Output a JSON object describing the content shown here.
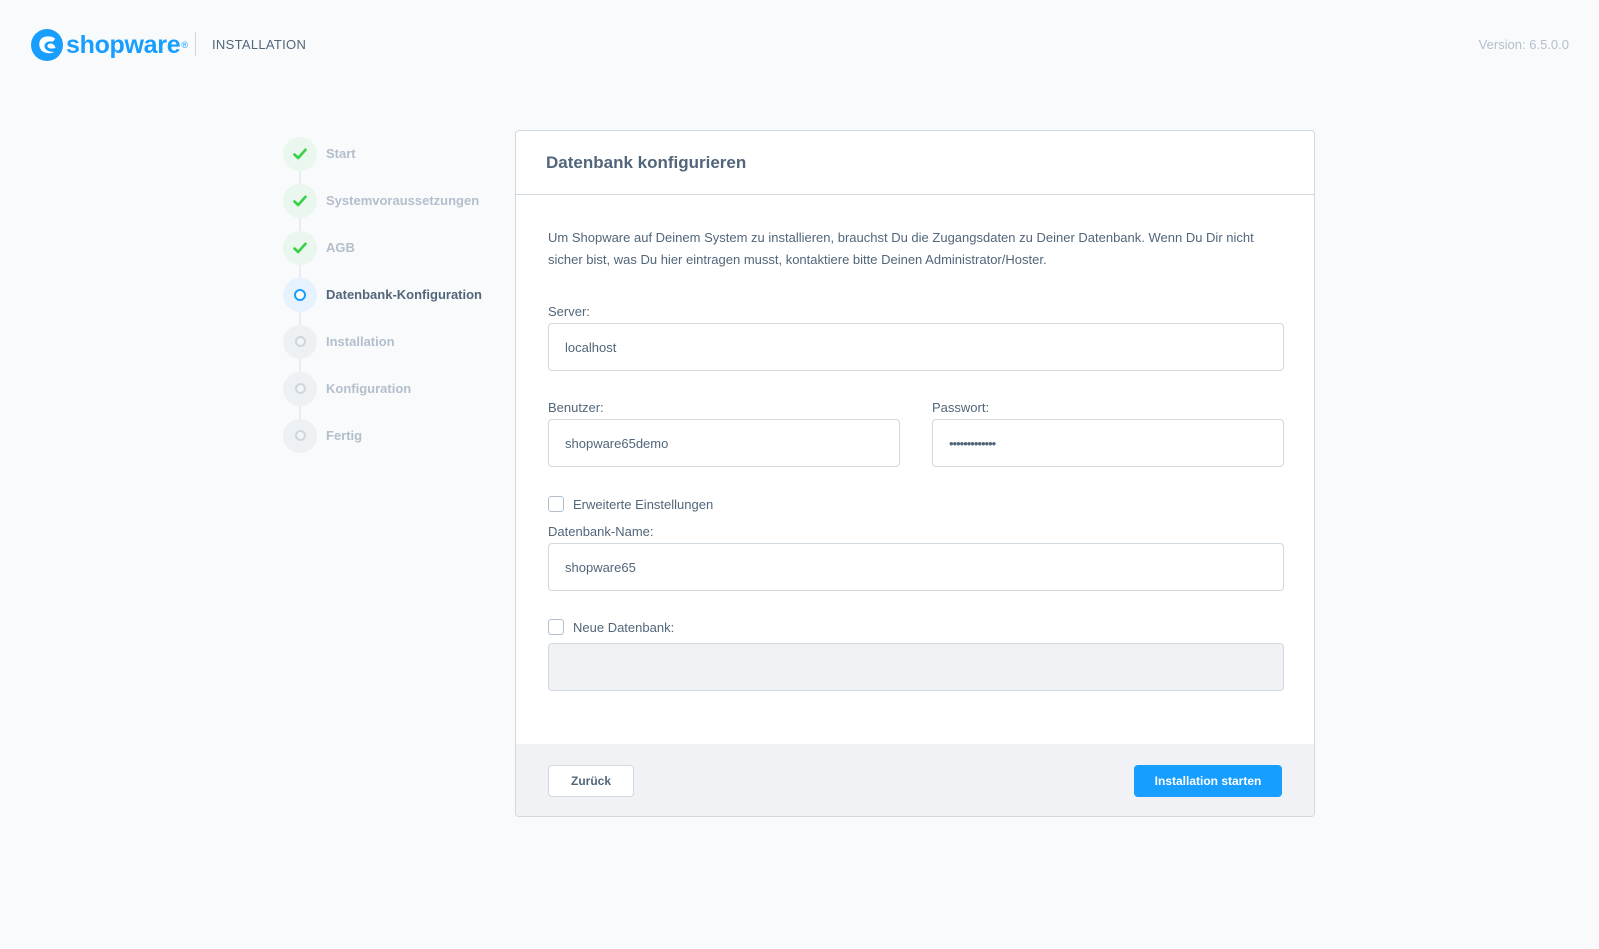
{
  "header": {
    "logo_text": "shopware",
    "logo_reg": "®",
    "section_title": "INSTALLATION",
    "version": "Version: 6.5.0.0"
  },
  "steps": [
    {
      "label": "Start",
      "state": "done"
    },
    {
      "label": "Systemvoraussetzungen",
      "state": "done"
    },
    {
      "label": "AGB",
      "state": "done"
    },
    {
      "label": "Datenbank-Konfiguration",
      "state": "active"
    },
    {
      "label": "Installation",
      "state": "pending"
    },
    {
      "label": "Konfiguration",
      "state": "pending"
    },
    {
      "label": "Fertig",
      "state": "pending"
    }
  ],
  "card": {
    "title": "Datenbank konfigurieren",
    "intro": "Um Shopware auf Deinem System zu installieren, brauchst Du die Zugangsdaten zu Deiner Datenbank. Wenn Du Dir nicht sicher bist, was Du hier eintragen musst, kontaktiere bitte Deinen Administrator/Hoster.",
    "server": {
      "label": "Server:",
      "value": "localhost"
    },
    "user": {
      "label": "Benutzer:",
      "value": "shopware65demo"
    },
    "password": {
      "label": "Passwort:",
      "value": "•••••••••••••"
    },
    "advanced": {
      "label": "Erweiterte Einstellungen",
      "checked": false
    },
    "db_name": {
      "label": "Datenbank-Name:",
      "value": "shopware65"
    },
    "new_db": {
      "label": "Neue Datenbank:",
      "checked": false,
      "value": ""
    },
    "back_label": "Zurück",
    "start_label": "Installation starten"
  },
  "colors": {
    "brand": "#189eff",
    "success": "#37d046",
    "text": "#52667a",
    "muted": "#b3bfcc"
  },
  "icons": {
    "logo": "shopware-logo-icon",
    "done": "check-icon",
    "active": "circle-active-icon",
    "pending": "circle-icon"
  }
}
